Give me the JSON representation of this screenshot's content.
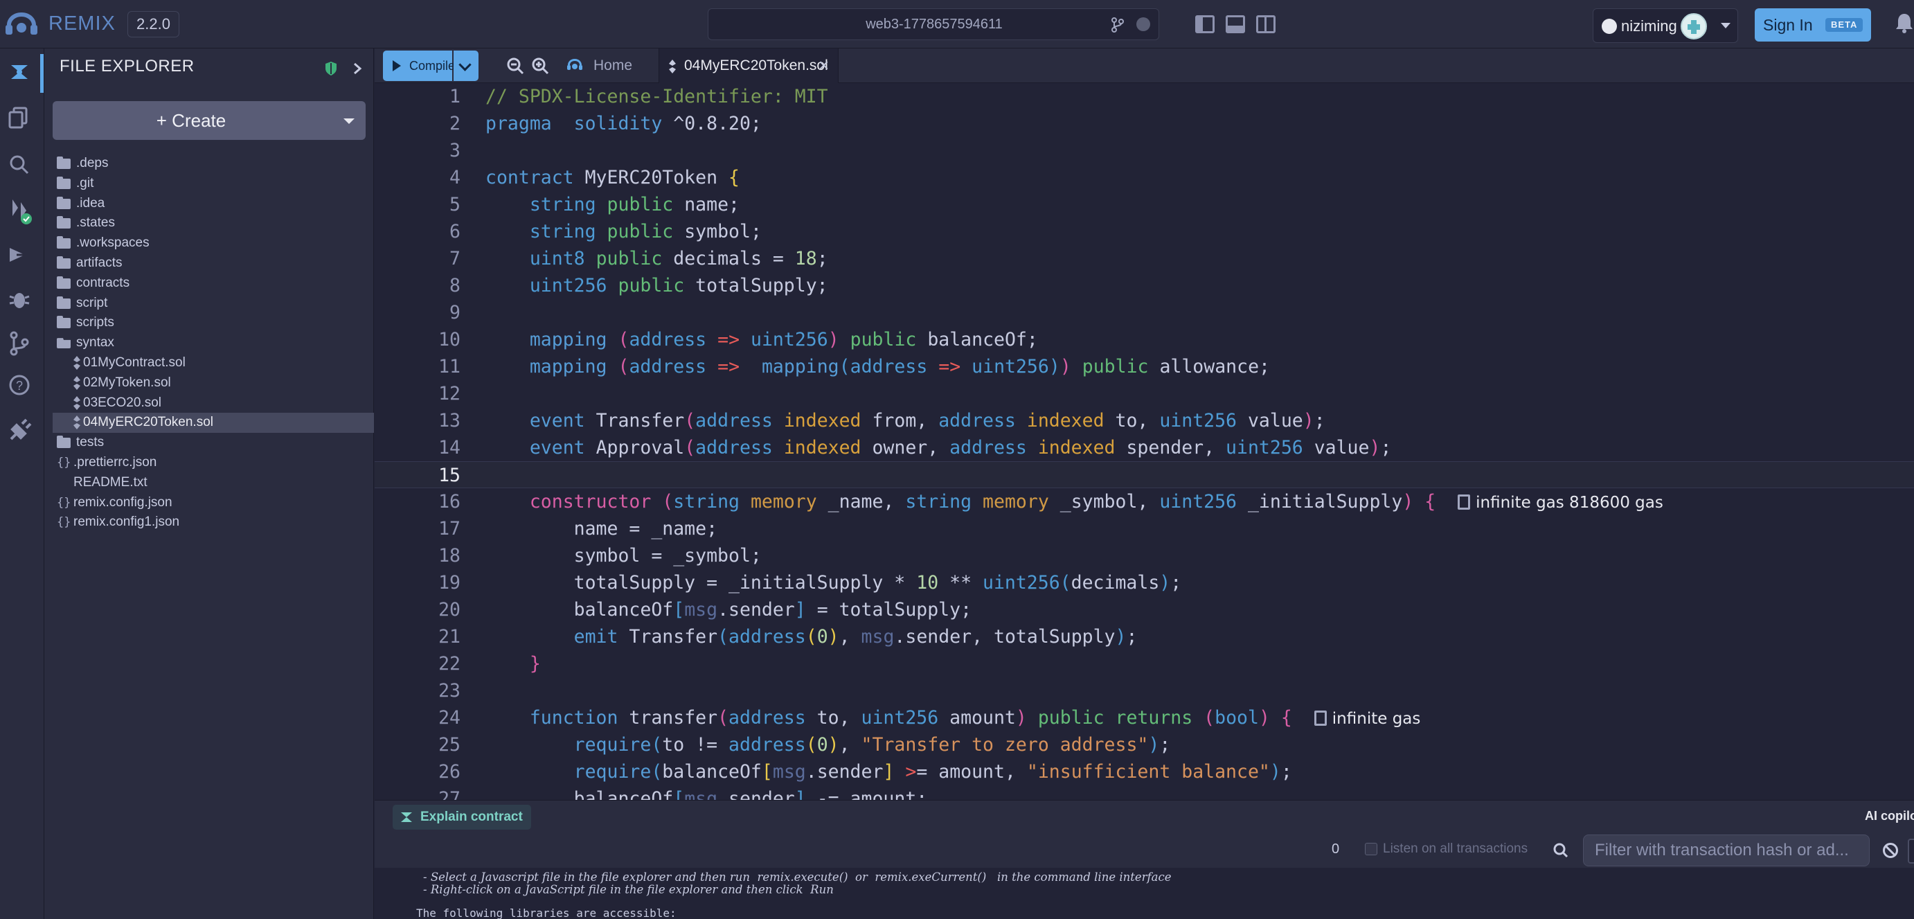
{
  "topbar": {
    "brand": "REMIX",
    "version": "2.2.0",
    "workspace": "web3-1778657594611",
    "user": "niziming",
    "signin": "Sign In",
    "beta": "BETA"
  },
  "explorer": {
    "title": "FILE EXPLORER",
    "create_label": "+ Create",
    "tree": [
      {
        "label": ".deps",
        "type": "folder",
        "depth": 0
      },
      {
        "label": ".git",
        "type": "folder",
        "depth": 0
      },
      {
        "label": ".idea",
        "type": "folder",
        "depth": 0
      },
      {
        "label": ".states",
        "type": "folder",
        "depth": 0
      },
      {
        "label": ".workspaces",
        "type": "folder",
        "depth": 0
      },
      {
        "label": "artifacts",
        "type": "folder",
        "depth": 0
      },
      {
        "label": "contracts",
        "type": "folder",
        "depth": 0
      },
      {
        "label": "script",
        "type": "folder",
        "depth": 0
      },
      {
        "label": "scripts",
        "type": "folder",
        "depth": 0
      },
      {
        "label": "syntax",
        "type": "folder-open",
        "depth": 0
      },
      {
        "label": "01MyContract.sol",
        "type": "sol",
        "depth": 1
      },
      {
        "label": "02MyToken.sol",
        "type": "sol",
        "depth": 1
      },
      {
        "label": "03ECO20.sol",
        "type": "sol",
        "depth": 1
      },
      {
        "label": "04MyERC20Token.sol",
        "type": "sol",
        "depth": 1,
        "selected": true
      },
      {
        "label": "tests",
        "type": "folder",
        "depth": 0
      },
      {
        "label": ".prettierrc.json",
        "type": "json",
        "depth": 0
      },
      {
        "label": "README.txt",
        "type": "txt",
        "depth": 0
      },
      {
        "label": "remix.config.json",
        "type": "json",
        "depth": 0
      },
      {
        "label": "remix.config1.json",
        "type": "json",
        "depth": 0
      }
    ]
  },
  "editor": {
    "compile_label": "Compile",
    "home_tab": "Home",
    "file_tab": "04MyERC20Token.sol",
    "current_line": 15,
    "lines": [
      [
        [
          "cm",
          "// SPDX-License-Identifier: MIT"
        ]
      ],
      [
        [
          "kw",
          "pragma"
        ],
        [
          "",
          "  "
        ],
        [
          "kw",
          "solidity"
        ],
        [
          "",
          " ^0.8.20;"
        ]
      ],
      [],
      [
        [
          "kw",
          "contract"
        ],
        [
          "",
          " MyERC20Token "
        ],
        [
          "br1",
          "{"
        ]
      ],
      [
        [
          "",
          "    "
        ],
        [
          "ty",
          "string"
        ],
        [
          "",
          " "
        ],
        [
          "pu",
          "public"
        ],
        [
          "",
          " name;"
        ]
      ],
      [
        [
          "",
          "    "
        ],
        [
          "ty",
          "string"
        ],
        [
          "",
          " "
        ],
        [
          "pu",
          "public"
        ],
        [
          "",
          " symbol;"
        ]
      ],
      [
        [
          "",
          "    "
        ],
        [
          "ty",
          "uint8"
        ],
        [
          "",
          " "
        ],
        [
          "pu",
          "public"
        ],
        [
          "",
          " decimals = "
        ],
        [
          "nu",
          "18"
        ],
        [
          "",
          ";"
        ]
      ],
      [
        [
          "",
          "    "
        ],
        [
          "ty",
          "uint256"
        ],
        [
          "",
          " "
        ],
        [
          "pu",
          "public"
        ],
        [
          "",
          " totalSupply;"
        ]
      ],
      [],
      [
        [
          "",
          "    "
        ],
        [
          "kw",
          "mapping"
        ],
        [
          "",
          " "
        ],
        [
          "br2",
          "("
        ],
        [
          "ty",
          "address"
        ],
        [
          "",
          " "
        ],
        [
          "op",
          "=>"
        ],
        [
          "",
          " "
        ],
        [
          "ty",
          "uint256"
        ],
        [
          "br2",
          ")"
        ],
        [
          "",
          " "
        ],
        [
          "pu",
          "public"
        ],
        [
          "",
          " balanceOf;"
        ]
      ],
      [
        [
          "",
          "    "
        ],
        [
          "kw",
          "mapping"
        ],
        [
          "",
          " "
        ],
        [
          "br2",
          "("
        ],
        [
          "ty",
          "address"
        ],
        [
          "",
          " "
        ],
        [
          "op",
          "=>"
        ],
        [
          "",
          "  "
        ],
        [
          "kw",
          "mapping"
        ],
        [
          "br3",
          "("
        ],
        [
          "ty",
          "address"
        ],
        [
          "",
          " "
        ],
        [
          "op",
          "=>"
        ],
        [
          "",
          " "
        ],
        [
          "ty",
          "uint256"
        ],
        [
          "br3",
          ")"
        ],
        [
          "br2",
          ")"
        ],
        [
          "",
          " "
        ],
        [
          "pu",
          "public"
        ],
        [
          "",
          " allowance;"
        ]
      ],
      [],
      [
        [
          "",
          "    "
        ],
        [
          "kw",
          "event"
        ],
        [
          "",
          " Transfer"
        ],
        [
          "br2",
          "("
        ],
        [
          "ty",
          "address"
        ],
        [
          "",
          " "
        ],
        [
          "ix",
          "indexed"
        ],
        [
          "",
          " from, "
        ],
        [
          "ty",
          "address"
        ],
        [
          "",
          " "
        ],
        [
          "ix",
          "indexed"
        ],
        [
          "",
          " to, "
        ],
        [
          "ty",
          "uint256"
        ],
        [
          "",
          " value"
        ],
        [
          "br2",
          ")"
        ],
        [
          "",
          ";"
        ]
      ],
      [
        [
          "",
          "    "
        ],
        [
          "kw",
          "event"
        ],
        [
          "",
          " Approval"
        ],
        [
          "br2",
          "("
        ],
        [
          "ty",
          "address"
        ],
        [
          "",
          " "
        ],
        [
          "ix",
          "indexed"
        ],
        [
          "",
          " owner, "
        ],
        [
          "ty",
          "address"
        ],
        [
          "",
          " "
        ],
        [
          "ix",
          "indexed"
        ],
        [
          "",
          " spender, "
        ],
        [
          "ty",
          "uint256"
        ],
        [
          "",
          " value"
        ],
        [
          "br2",
          ")"
        ],
        [
          "",
          ";"
        ]
      ],
      [],
      [
        [
          "",
          "    "
        ],
        [
          "co",
          "constructor"
        ],
        [
          "",
          " "
        ],
        [
          "br2",
          "("
        ],
        [
          "ty",
          "string"
        ],
        [
          "",
          " "
        ],
        [
          "mo",
          "memory"
        ],
        [
          "",
          " _name, "
        ],
        [
          "ty",
          "string"
        ],
        [
          "",
          " "
        ],
        [
          "mo",
          "memory"
        ],
        [
          "",
          " _symbol, "
        ],
        [
          "ty",
          "uint256"
        ],
        [
          "",
          " _initialSupply"
        ],
        [
          "br2",
          ")"
        ],
        [
          "",
          " "
        ],
        [
          "br2",
          "{"
        ],
        [
          "",
          "  "
        ],
        [
          "gas",
          "pump"
        ],
        [
          "gas",
          "infinite gas 818600 gas"
        ]
      ],
      [
        [
          "",
          "        name = _name;"
        ]
      ],
      [
        [
          "",
          "        symbol = _symbol;"
        ]
      ],
      [
        [
          "",
          "        totalSupply = _initialSupply * "
        ],
        [
          "nu",
          "10"
        ],
        [
          "",
          " ** "
        ],
        [
          "ty",
          "uint256"
        ],
        [
          "br3",
          "("
        ],
        [
          "",
          "decimals"
        ],
        [
          "br3",
          ")"
        ],
        [
          "",
          ";"
        ]
      ],
      [
        [
          "",
          "        balanceOf"
        ],
        [
          "br3",
          "["
        ],
        [
          "ms",
          "msg"
        ],
        [
          "",
          ".sender"
        ],
        [
          "br3",
          "]"
        ],
        [
          "",
          " = totalSupply;"
        ]
      ],
      [
        [
          "",
          "        "
        ],
        [
          "kw",
          "emit"
        ],
        [
          "",
          " Transfer"
        ],
        [
          "br3",
          "("
        ],
        [
          "ty",
          "address"
        ],
        [
          "br1",
          "("
        ],
        [
          "nu",
          "0"
        ],
        [
          "br1",
          ")"
        ],
        [
          "",
          ", "
        ],
        [
          "ms",
          "msg"
        ],
        [
          "",
          ".sender, totalSupply"
        ],
        [
          "br3",
          ")"
        ],
        [
          "",
          ";"
        ]
      ],
      [
        [
          "",
          "    "
        ],
        [
          "br2",
          "}"
        ]
      ],
      [],
      [
        [
          "",
          "    "
        ],
        [
          "kw",
          "function"
        ],
        [
          "",
          " transfer"
        ],
        [
          "br2",
          "("
        ],
        [
          "ty",
          "address"
        ],
        [
          "",
          " to, "
        ],
        [
          "ty",
          "uint256"
        ],
        [
          "",
          " amount"
        ],
        [
          "br2",
          ")"
        ],
        [
          "",
          " "
        ],
        [
          "pu",
          "public"
        ],
        [
          "",
          " "
        ],
        [
          "pu",
          "returns"
        ],
        [
          "",
          " "
        ],
        [
          "br2",
          "("
        ],
        [
          "ty",
          "bool"
        ],
        [
          "br2",
          ")"
        ],
        [
          "",
          " "
        ],
        [
          "br2",
          "{"
        ],
        [
          "",
          "  "
        ],
        [
          "gas",
          "pump"
        ],
        [
          "gas",
          "infinite gas"
        ]
      ],
      [
        [
          "",
          "        "
        ],
        [
          "kw",
          "require"
        ],
        [
          "br3",
          "("
        ],
        [
          "",
          "to != "
        ],
        [
          "ty",
          "address"
        ],
        [
          "br1",
          "("
        ],
        [
          "nu",
          "0"
        ],
        [
          "br1",
          ")"
        ],
        [
          "",
          ", "
        ],
        [
          "st",
          "\"Transfer to zero address\""
        ],
        [
          "br3",
          ")"
        ],
        [
          "",
          ";"
        ]
      ],
      [
        [
          "",
          "        "
        ],
        [
          "kw",
          "require"
        ],
        [
          "br3",
          "("
        ],
        [
          "",
          "balanceOf"
        ],
        [
          "br1",
          "["
        ],
        [
          "ms",
          "msg"
        ],
        [
          "",
          ".sender"
        ],
        [
          "br1",
          "]"
        ],
        [
          "",
          " "
        ],
        [
          "op",
          ">"
        ],
        [
          "",
          "= amount, "
        ],
        [
          "st",
          "\"insufficient balance\""
        ],
        [
          "br3",
          ")"
        ],
        [
          "",
          ";"
        ]
      ],
      [
        [
          "",
          "        balanceOf"
        ],
        [
          "br3",
          "["
        ],
        [
          "ms",
          "msg"
        ],
        [
          "",
          ".sender"
        ],
        [
          "br3",
          "]"
        ],
        [
          "",
          " -= amount;"
        ]
      ]
    ]
  },
  "ai": {
    "explain_label": "Explain contract",
    "copilot_label": "AI copilot"
  },
  "terminal": {
    "tx_count": "0",
    "listen_label": "Listen on all transactions",
    "filter_placeholder": "Filter with transaction hash or ad...",
    "line1": "- Select a Javascript file in the file explorer and then run  remix.execute()  or  remix.exeCurrent()   in the command line interface",
    "line2": "- Right-click on a JavaScript file in the file explorer and then click  Run",
    "line3": "The following libraries are accessible:"
  },
  "colors": {
    "accent": "#5fa8e8",
    "panel": "#2a2c3f",
    "editor_bg": "#222336"
  }
}
